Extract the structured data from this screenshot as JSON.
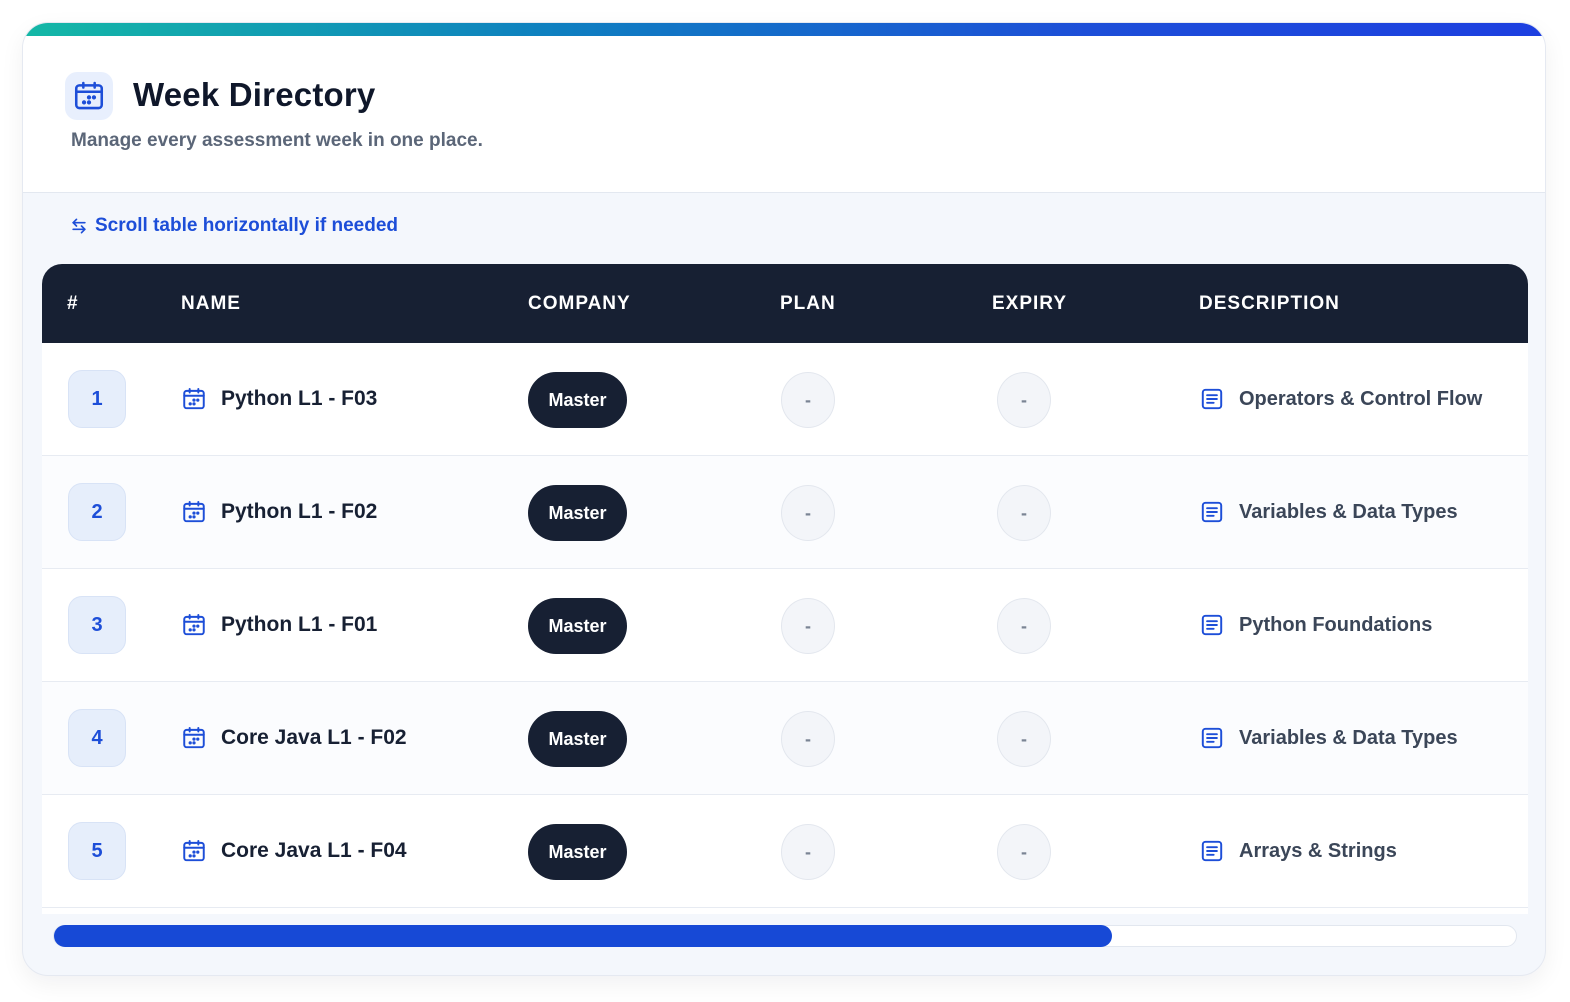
{
  "header": {
    "title": "Week Directory",
    "subtitle": "Manage every assessment week in one place.",
    "icon": "calendar-icon"
  },
  "hint": {
    "text": "Scroll table horizontally if needed",
    "icon": "swap-arrows-icon"
  },
  "table": {
    "columns": [
      "#",
      "NAME",
      "COMPANY",
      "PLAN",
      "EXPIRY",
      "DESCRIPTION"
    ],
    "rows": [
      {
        "num": "1",
        "name": "Python L1 - F03",
        "company": "Master",
        "plan": "-",
        "expiry": "-",
        "description": "Operators & Control Flow"
      },
      {
        "num": "2",
        "name": "Python L1 - F02",
        "company": "Master",
        "plan": "-",
        "expiry": "-",
        "description": "Variables & Data Types"
      },
      {
        "num": "3",
        "name": "Python L1 - F01",
        "company": "Master",
        "plan": "-",
        "expiry": "-",
        "description": "Python Foundations"
      },
      {
        "num": "4",
        "name": "Core Java L1 - F02",
        "company": "Master",
        "plan": "-",
        "expiry": "-",
        "description": "Variables & Data Types"
      },
      {
        "num": "5",
        "name": "Core Java L1 - F04",
        "company": "Master",
        "plan": "-",
        "expiry": "-",
        "description": "Arrays & Strings"
      }
    ]
  },
  "scrollbar": {
    "thumb_fraction": 0.724
  },
  "colors": {
    "accent": "#1d4ed8",
    "header_dark": "#172033",
    "accent_gradient_start": "#14b8a6"
  }
}
